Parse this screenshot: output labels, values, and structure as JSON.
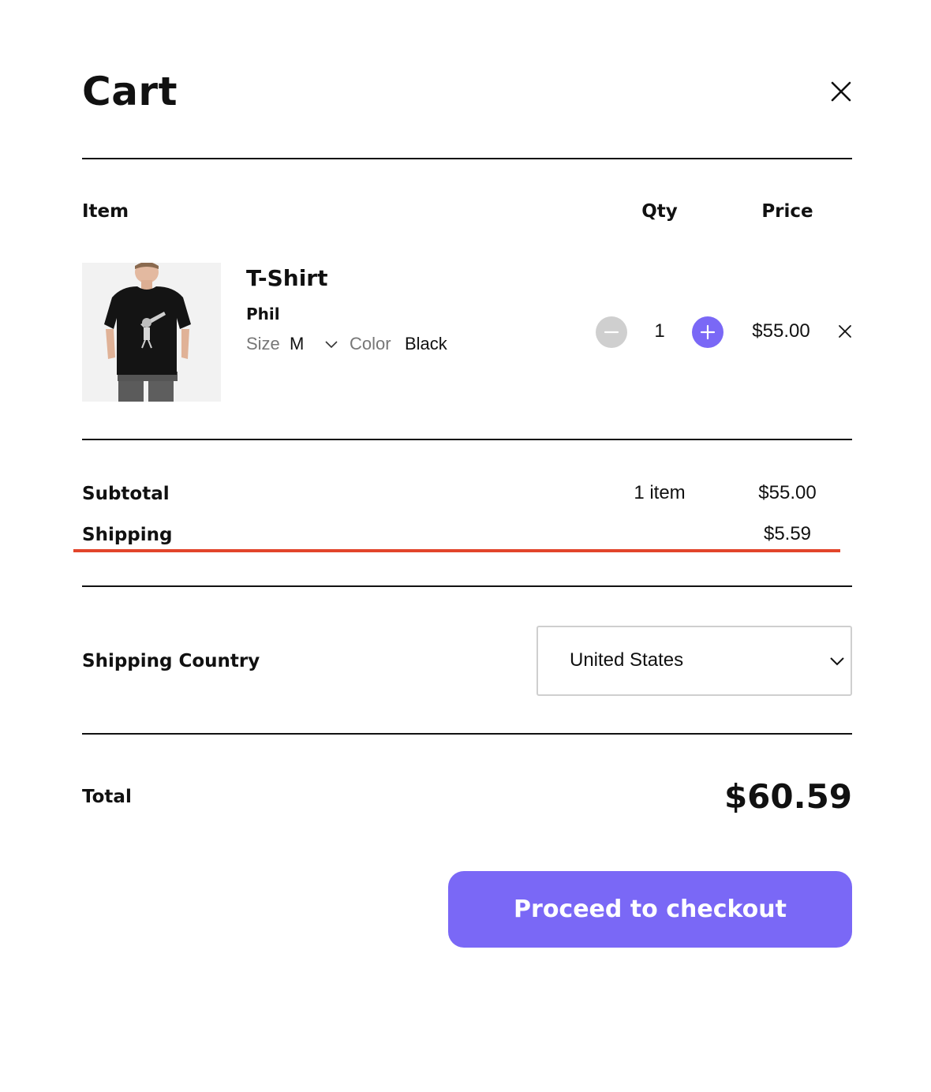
{
  "cart": {
    "title": "Cart",
    "columns": {
      "item": "Item",
      "qty": "Qty",
      "price": "Price"
    },
    "item": {
      "name": "T-Shirt",
      "variant": "Phil",
      "size_label": "Size",
      "size_value": "M",
      "color_label": "Color",
      "color_value": "Black",
      "quantity": "1",
      "price": "$55.00"
    },
    "summary": {
      "subtotal_label": "Subtotal",
      "item_count": "1 item",
      "subtotal_value": "$55.00",
      "shipping_label": "Shipping",
      "shipping_value": "$5.59"
    },
    "shipping_country": {
      "label": "Shipping Country",
      "selected": "United States"
    },
    "total": {
      "label": "Total",
      "value": "$60.59"
    },
    "checkout_label": "Proceed to checkout"
  },
  "colors": {
    "accent": "#7a68f6",
    "highlight_underline": "#e2452b",
    "minus_button": "#cfcfcf",
    "text": "#111111"
  },
  "icons": {
    "close": "close-icon",
    "minus": "minus-icon",
    "plus": "plus-icon",
    "remove": "remove-icon",
    "size_dropdown": "chevron-down-icon",
    "country_dropdown": "chevron-down-icon"
  }
}
